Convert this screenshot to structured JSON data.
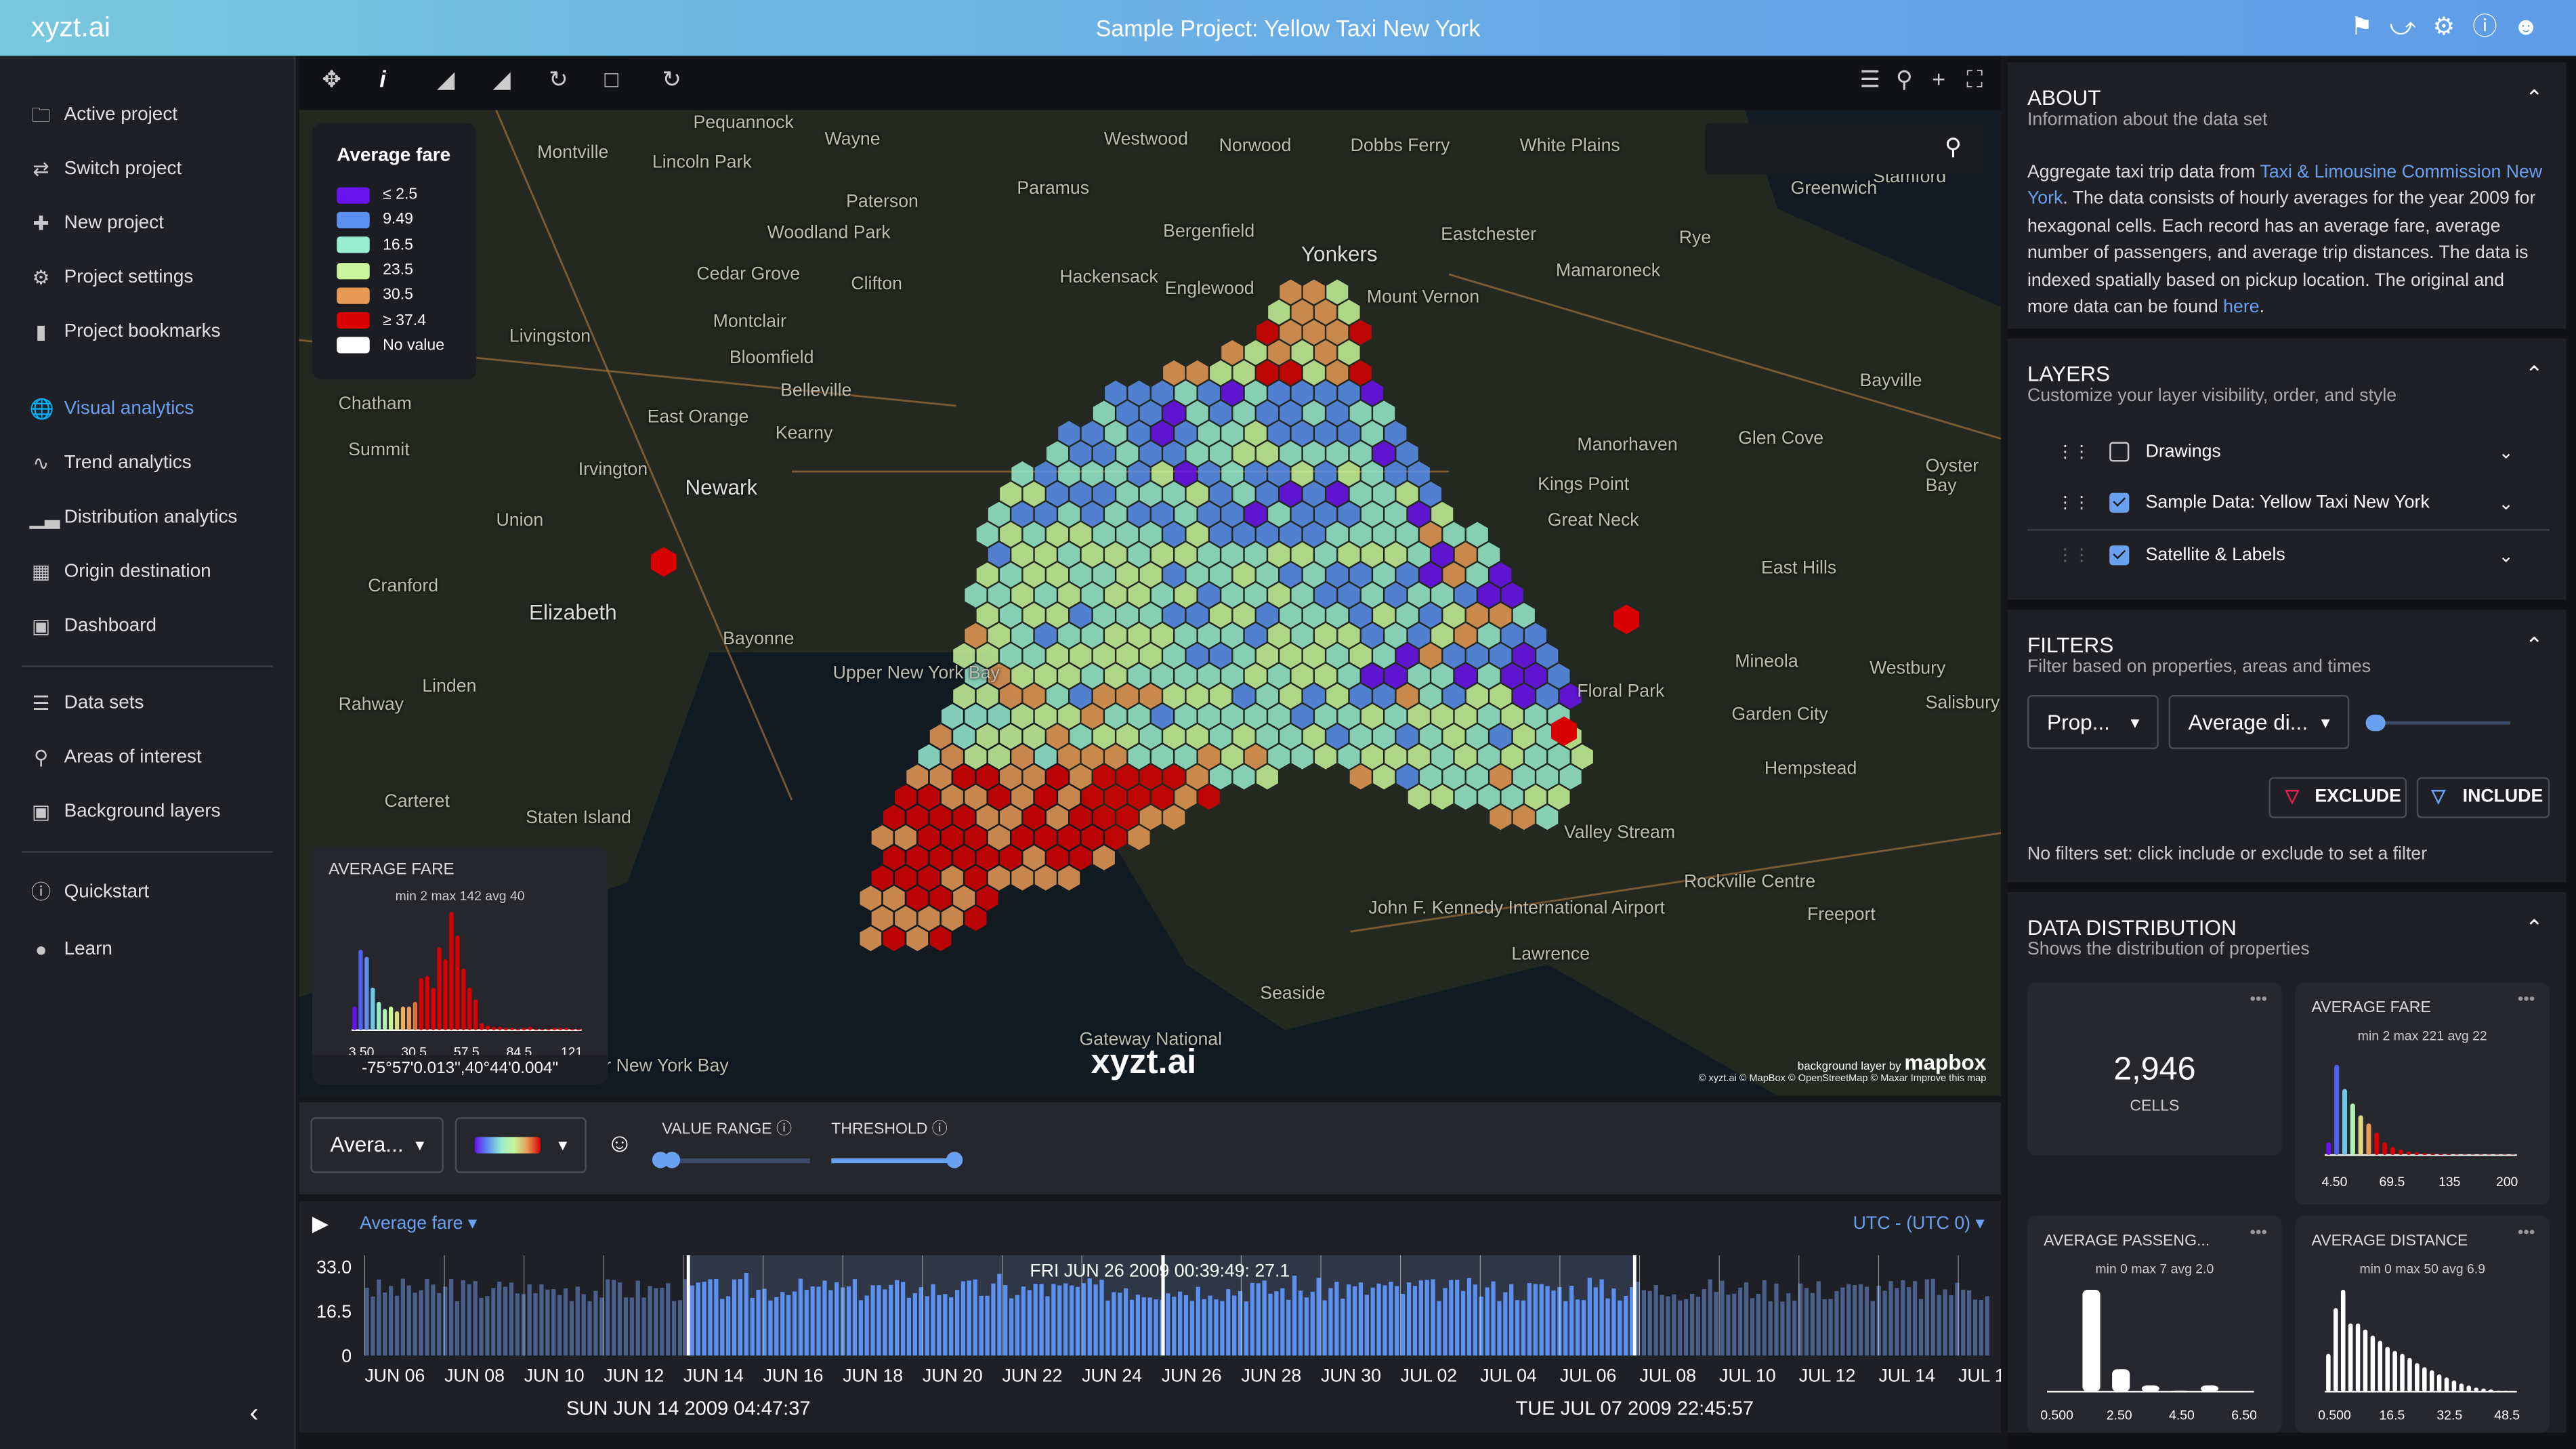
{
  "header": {
    "logo": "xyzt.ai",
    "title": "Sample Project: Yellow Taxi New York",
    "icons": [
      "bookmark-icon",
      "share-icon",
      "gear-icon",
      "help-icon",
      "account-icon"
    ]
  },
  "sidebar": {
    "items": [
      {
        "label": "Active project",
        "icon": "folder-icon"
      },
      {
        "label": "Switch project",
        "icon": "swap-icon"
      },
      {
        "label": "New project",
        "icon": "new-folder-icon"
      },
      {
        "label": "Project settings",
        "icon": "gear-icon"
      },
      {
        "label": "Project bookmarks",
        "icon": "bookmarks-icon"
      },
      {
        "label": "Visual analytics",
        "icon": "globe-icon",
        "active": true
      },
      {
        "label": "Trend analytics",
        "icon": "trend-icon"
      },
      {
        "label": "Distribution analytics",
        "icon": "bar-chart-icon"
      },
      {
        "label": "Origin destination",
        "icon": "grid-icon"
      },
      {
        "label": "Dashboard",
        "icon": "dashboard-icon"
      },
      {
        "label": "Data sets",
        "icon": "list-icon"
      },
      {
        "label": "Areas of interest",
        "icon": "area-search-icon"
      },
      {
        "label": "Background layers",
        "icon": "map-icon"
      },
      {
        "label": "Quickstart",
        "icon": "info-icon"
      },
      {
        "label": "Learn",
        "icon": "lightbulb-icon"
      }
    ]
  },
  "toolbar": {
    "tools": [
      "move-icon",
      "info-cursor-icon",
      "select-area-filter-icon",
      "deselect-area-filter-icon",
      "add-polygon-icon",
      "add-rectangle-icon",
      "add-lasso-icon"
    ],
    "right_tools": [
      "list-icon",
      "search-icon",
      "zoom-in-icon",
      "fullscreen-icon"
    ]
  },
  "map": {
    "legend": {
      "title": "Average fare",
      "items": [
        {
          "label": "≤ 2.5",
          "color": "#6a12f0"
        },
        {
          "label": "9.49",
          "color": "#5b8ff0"
        },
        {
          "label": "16.5",
          "color": "#98ecd0"
        },
        {
          "label": "23.5",
          "color": "#c8f59a"
        },
        {
          "label": "30.5",
          "color": "#e89a55"
        },
        {
          "label": "≥ 37.4",
          "color": "#d80000"
        },
        {
          "label": "No value",
          "color": "#ffffff"
        }
      ]
    },
    "labels": [
      "Pequannock",
      "Wayne",
      "Montville",
      "Lincoln Park",
      "Paterson",
      "Woodland Park",
      "Cedar Grove",
      "Clifton",
      "Montclair",
      "Livingston",
      "Bloomfield",
      "Belleville",
      "East Orange",
      "Kearny",
      "Newark",
      "Irvington",
      "Union",
      "Elizabeth",
      "Bayonne",
      "Cranford",
      "Chatham",
      "Summit",
      "Rahway",
      "Linden",
      "Carteret",
      "Hackensack",
      "Englewood",
      "Bergenfield",
      "Paramus",
      "Westwood",
      "Norwood",
      "Dobbs Ferry",
      "White Plains",
      "Yonkers",
      "Mount Vernon",
      "Eastchester",
      "Mamaroneck",
      "Greenwich",
      "Rye",
      "Bayville",
      "Glen Cove",
      "Manorhaven",
      "Kings Point",
      "Great Neck",
      "East Hills",
      "Oyster Bay",
      "Mineola",
      "Westbury",
      "Garden City",
      "Hempstead",
      "Salisbury",
      "Floral Park",
      "Valley Stream",
      "Rockville Centre",
      "Freeport",
      "Lawrence",
      "John F. Kennedy International Airport",
      "Upper New York Bay",
      "Lower New York Bay",
      "Staten Island",
      "Gateway National",
      "Seaside",
      "Stamford"
    ],
    "search_icon": "search-icon",
    "inset": {
      "title": "AVERAGE FARE",
      "stats": "min 2 max 142 avg 40",
      "ticks": [
        "3.50",
        "30.5",
        "57.5",
        "84.5",
        "121"
      ],
      "bins": [
        10,
        34,
        31,
        18,
        12,
        9,
        10,
        8,
        10,
        10,
        12,
        22,
        23,
        18,
        35,
        30,
        50,
        40,
        26,
        18,
        13,
        3,
        2,
        1.5,
        1.5,
        1,
        1,
        0.5,
        1,
        1.5,
        0.5,
        0.5,
        0.5,
        1,
        1,
        1,
        0.5,
        0.5
      ]
    },
    "coordinate": "-75°57'0.013\",40°44'0.004\"",
    "watermark": "xyzt.ai",
    "attribution_by": "background layer by",
    "attribution_brand": "mapbox",
    "attribution": "© xyzt.ai © MapBox © OpenStreetMap © Maxar Improve this map"
  },
  "controls": {
    "property_select": "Avera...",
    "palette_icon": "palette-icon",
    "value_range_label": "VALUE RANGE",
    "threshold_label": "THRESHOLD",
    "value_range": [
      0.0,
      0.08
    ],
    "threshold": 1.0
  },
  "timeline": {
    "play_icon": "play-icon",
    "property": "Average fare",
    "timezone": "UTC - (UTC 0)",
    "y_ticks": [
      "33.0",
      "16.5",
      "0"
    ],
    "x_ticks": [
      "JUN 06",
      "JUN 08",
      "JUN 10",
      "JUN 12",
      "JUN 14",
      "JUN 16",
      "JUN 18",
      "JUN 20",
      "JUN 22",
      "JUN 24",
      "JUN 26",
      "JUN 28",
      "JUN 30",
      "JUL 02",
      "JUL 04",
      "JUL 06",
      "JUL 08",
      "JUL 10",
      "JUL 12",
      "JUL 14",
      "JUL 1"
    ],
    "hover": "FRI JUN 26 2009 00:39:49: 27.1",
    "range_start": "SUN JUN 14 2009 04:47:37",
    "range_end": "TUE JUL 07 2009 22:45:57"
  },
  "about": {
    "title": "ABOUT",
    "subtitle": "Information about the data set",
    "text1": "Aggregate taxi trip data from ",
    "link1": "Taxi & Limousine Commission New York",
    "text2": ". The data consists of hourly averages for the year 2009 for hexagonal cells. Each record has an average fare, average number of passengers, and average trip distances. The data is indexed spatially based on pickup location. The original and more data can be found ",
    "link2": "here",
    "text3": "."
  },
  "layers": {
    "title": "LAYERS",
    "subtitle": "Customize your layer visibility, order, and style",
    "items": [
      {
        "label": "Drawings",
        "checked": false
      },
      {
        "label": "Sample Data: Yellow Taxi New York",
        "checked": true
      },
      {
        "label": "Satellite & Labels",
        "checked": true
      }
    ]
  },
  "filters": {
    "title": "FILTERS",
    "subtitle": "Filter based on properties, areas and times",
    "type_select": "Prop...",
    "property_select": "Average di...",
    "slider": 0.03,
    "exclude": "EXCLUDE",
    "include": "INCLUDE",
    "status": "No filters set: click include or exclude to set a filter"
  },
  "distribution": {
    "title": "DATA DISTRIBUTION",
    "subtitle": "Shows the distribution of properties",
    "cells": {
      "value": "2,946",
      "label": "CELLS"
    },
    "fare": {
      "title": "AVERAGE FARE",
      "stats": "min 2 max 221 avg 22",
      "ticks": [
        "4.50",
        "69.5",
        "135",
        "200"
      ],
      "bins": [
        14,
        100,
        73,
        57,
        44,
        35,
        25,
        14,
        9,
        6,
        4,
        3,
        2,
        1.5,
        1,
        1,
        0.5,
        0.5,
        0.5,
        0.5,
        0.5,
        0.5,
        0.5,
        0.5
      ]
    },
    "passengers": {
      "title": "AVERAGE PASSENG...",
      "stats": "min 0 max 7 avg 2.0",
      "ticks": [
        "0.500",
        "2.50",
        "4.50",
        "6.50"
      ],
      "bins": [
        0,
        100,
        22,
        6,
        1,
        6,
        0
      ]
    },
    "distance": {
      "title": "AVERAGE DISTANCE",
      "stats": "min 0 max 50 avg 6.9",
      "ticks": [
        "0.500",
        "16.5",
        "32.5",
        "48.5"
      ],
      "bins": [
        37,
        82,
        100,
        67,
        67,
        61,
        55,
        50,
        44,
        40,
        37,
        33,
        28,
        24,
        21,
        17,
        14,
        11,
        8,
        6,
        4,
        3,
        2,
        1,
        1,
        0.5
      ]
    }
  }
}
